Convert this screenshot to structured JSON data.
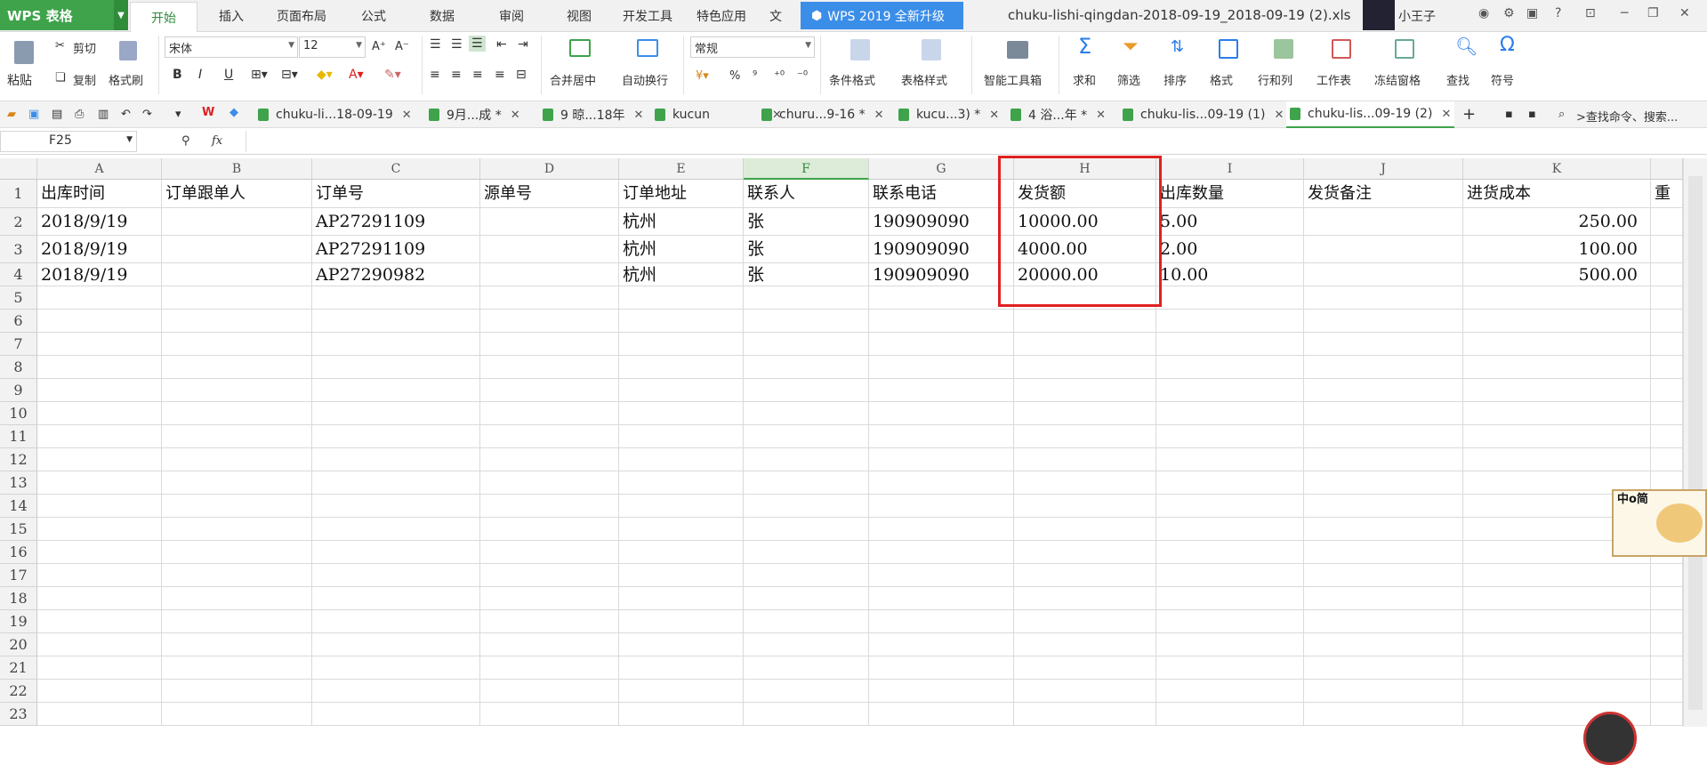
{
  "app": {
    "name": "WPS 表格",
    "upgrade": "WPS 2019 全新升级",
    "filename": "chuku-lishi-qingdan-2018-09-19_2018-09-19 (2).xls",
    "user": "小王子"
  },
  "menu": {
    "tabs": [
      "开始",
      "插入",
      "页面布局",
      "公式",
      "数据",
      "审阅",
      "视图",
      "开发工具",
      "特色应用",
      "文"
    ]
  },
  "ribbon": {
    "paste": "粘贴",
    "cut": "剪切",
    "copy": "复制",
    "format_painter": "格式刷",
    "font_name": "宋体",
    "font_size": "12",
    "bold": "B",
    "italic": "I",
    "underline": "U",
    "merge_center": "合并居中",
    "wrap": "自动换行",
    "number_format": "常规",
    "percent": "%",
    "comma": "⁹",
    "cond_format": "条件格式",
    "table_style": "表格样式",
    "smart_toolbox": "智能工具箱",
    "sum": "求和",
    "filter": "筛选",
    "sort": "排序",
    "format": "格式",
    "row_col": "行和列",
    "worksheet": "工作表",
    "freeze": "冻结窗格",
    "find": "查找",
    "symbol": "符号"
  },
  "file_tabs": [
    "chuku-li...18-09-19",
    "9月...成 *",
    "9 晾...18年",
    "kucun",
    "churu...9-16 *",
    "kucu...3) *",
    "4 浴...年 *",
    "chuku-lis...09-19 (1)",
    "chuku-lis...09-19 (2)"
  ],
  "search_command": ">查找命令、搜索...",
  "formula_bar": {
    "name_box": "F25",
    "fx": "fx",
    "content": ""
  },
  "sheet": {
    "columns": [
      "A",
      "B",
      "C",
      "D",
      "E",
      "F",
      "G",
      "H",
      "I",
      "J",
      "K"
    ],
    "col_more_header": "重",
    "headers": [
      "出库时间",
      "订单跟单人",
      "订单号",
      "源单号",
      "订单地址",
      "联系人",
      "联系电话",
      "发货额",
      "出库数量",
      "发货备注",
      "进货成本"
    ],
    "rows": [
      [
        "2018/9/19",
        "",
        "AP27291109",
        "",
        "杭州",
        "张",
        "190909090",
        "10000.00",
        "5.00",
        "",
        "250.00"
      ],
      [
        "2018/9/19",
        "",
        "AP27291109",
        "",
        "杭州",
        "张",
        "190909090",
        "4000.00",
        "2.00",
        "",
        "100.00"
      ],
      [
        "2018/9/19",
        "",
        "AP27290982",
        "",
        "杭州",
        "张",
        "190909090",
        "20000.00",
        "10.00",
        "",
        "500.00"
      ]
    ],
    "row_numbers": [
      "1",
      "2",
      "3",
      "4",
      "5",
      "6",
      "7",
      "8",
      "9",
      "10",
      "11",
      "12",
      "13",
      "14",
      "15",
      "16",
      "17",
      "18",
      "19",
      "20",
      "21",
      "22",
      "23"
    ],
    "selected_column": "F"
  },
  "sticker_text": "中o简"
}
